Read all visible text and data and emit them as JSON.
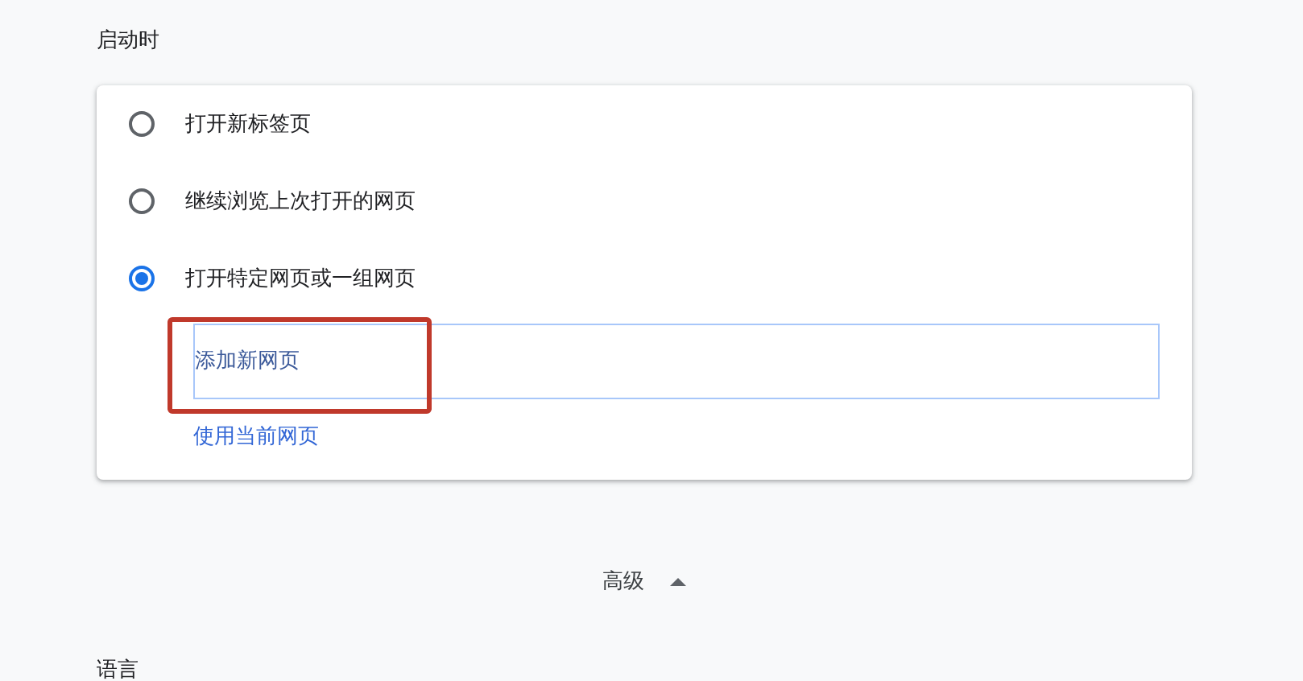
{
  "section_title": "启动时",
  "startup_options": [
    {
      "label": "打开新标签页",
      "selected": false
    },
    {
      "label": "继续浏览上次打开的网页",
      "selected": false
    },
    {
      "label": "打开特定网页或一组网页",
      "selected": true
    }
  ],
  "add_page_field": {
    "placeholder": "添加新网页",
    "highlighted": true
  },
  "use_current_link": "使用当前网页",
  "advanced_toggle": {
    "label": "高级",
    "expanded": true
  },
  "next_section_title": "语言"
}
